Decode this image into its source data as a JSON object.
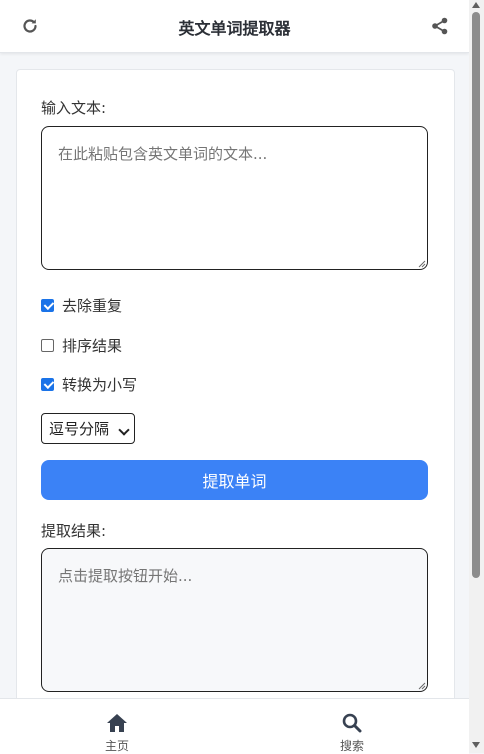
{
  "header": {
    "title": "英文单词提取器",
    "refresh_icon": "refresh-icon",
    "share_icon": "share-icon"
  },
  "form": {
    "input_label": "输入文本:",
    "input_placeholder": "在此粘贴包含英文单词的文本...",
    "input_value": "",
    "options": [
      {
        "label": "去除重复",
        "checked": true
      },
      {
        "label": "排序结果",
        "checked": false
      },
      {
        "label": "转换为小写",
        "checked": true
      }
    ],
    "separator_selected": "逗号分隔",
    "extract_button": "提取单词",
    "result_label": "提取结果:",
    "result_placeholder": "点击提取按钮开始...",
    "result_value": ""
  },
  "bottom_nav": {
    "items": [
      {
        "label": "主页",
        "icon": "home-icon"
      },
      {
        "label": "搜索",
        "icon": "search-icon"
      }
    ]
  },
  "colors": {
    "accent": "#3b82f6",
    "checkbox": "#1a73e8"
  }
}
